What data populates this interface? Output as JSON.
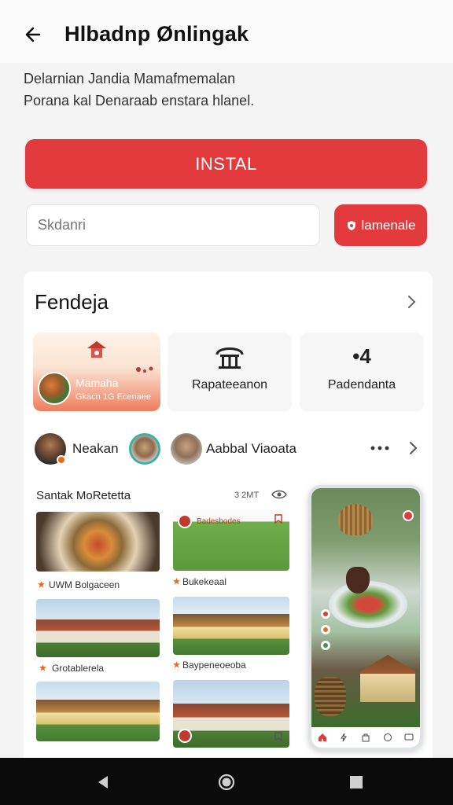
{
  "header": {
    "title": "Hlbadnp Ønlingak"
  },
  "description": {
    "line1": "Delarnian Jandia Mamafmemalan",
    "line2": "Porana kal Denaraab enstara hlanel."
  },
  "install_button": {
    "label": "INSTAL"
  },
  "search": {
    "placeholder": "Skdanri"
  },
  "action_button": {
    "label": "lamenale"
  },
  "section": {
    "title": "Fendeja",
    "tiles": [
      {
        "title": "Mamaha",
        "subtitle": "Gkacn 1G Ecenaee"
      },
      {
        "label": "Rapateeanon"
      },
      {
        "label": "Padendanta",
        "icon_text": "•4"
      }
    ]
  },
  "profiles": [
    {
      "name": "Neakan"
    },
    {
      "name": "Aabbal Viaoata"
    }
  ],
  "grid": {
    "heading": "Santak MoRetetta",
    "meta": "3 2MT",
    "items": [
      {
        "caption": "UWM Bolgaceen",
        "image": "food-basket"
      },
      {
        "caption": "Bukekeaal",
        "image": "food-plates",
        "overlay_title": "Badesbodes"
      },
      {
        "caption": "Grotablerela",
        "image": "village-houses"
      },
      {
        "caption": "Baypeneoeoba",
        "image": "village-houses"
      },
      {
        "caption": "",
        "image": "village-houses"
      },
      {
        "caption": "",
        "image": "village-houses"
      }
    ]
  },
  "phone_preview": {
    "nav_icons": [
      "home-icon",
      "flash-icon",
      "bag-icon",
      "chat-icon",
      "message-icon"
    ]
  },
  "colors": {
    "accent": "#e23a3d",
    "background": "#f4f4f5",
    "system_bar": "#0b0b0b"
  }
}
